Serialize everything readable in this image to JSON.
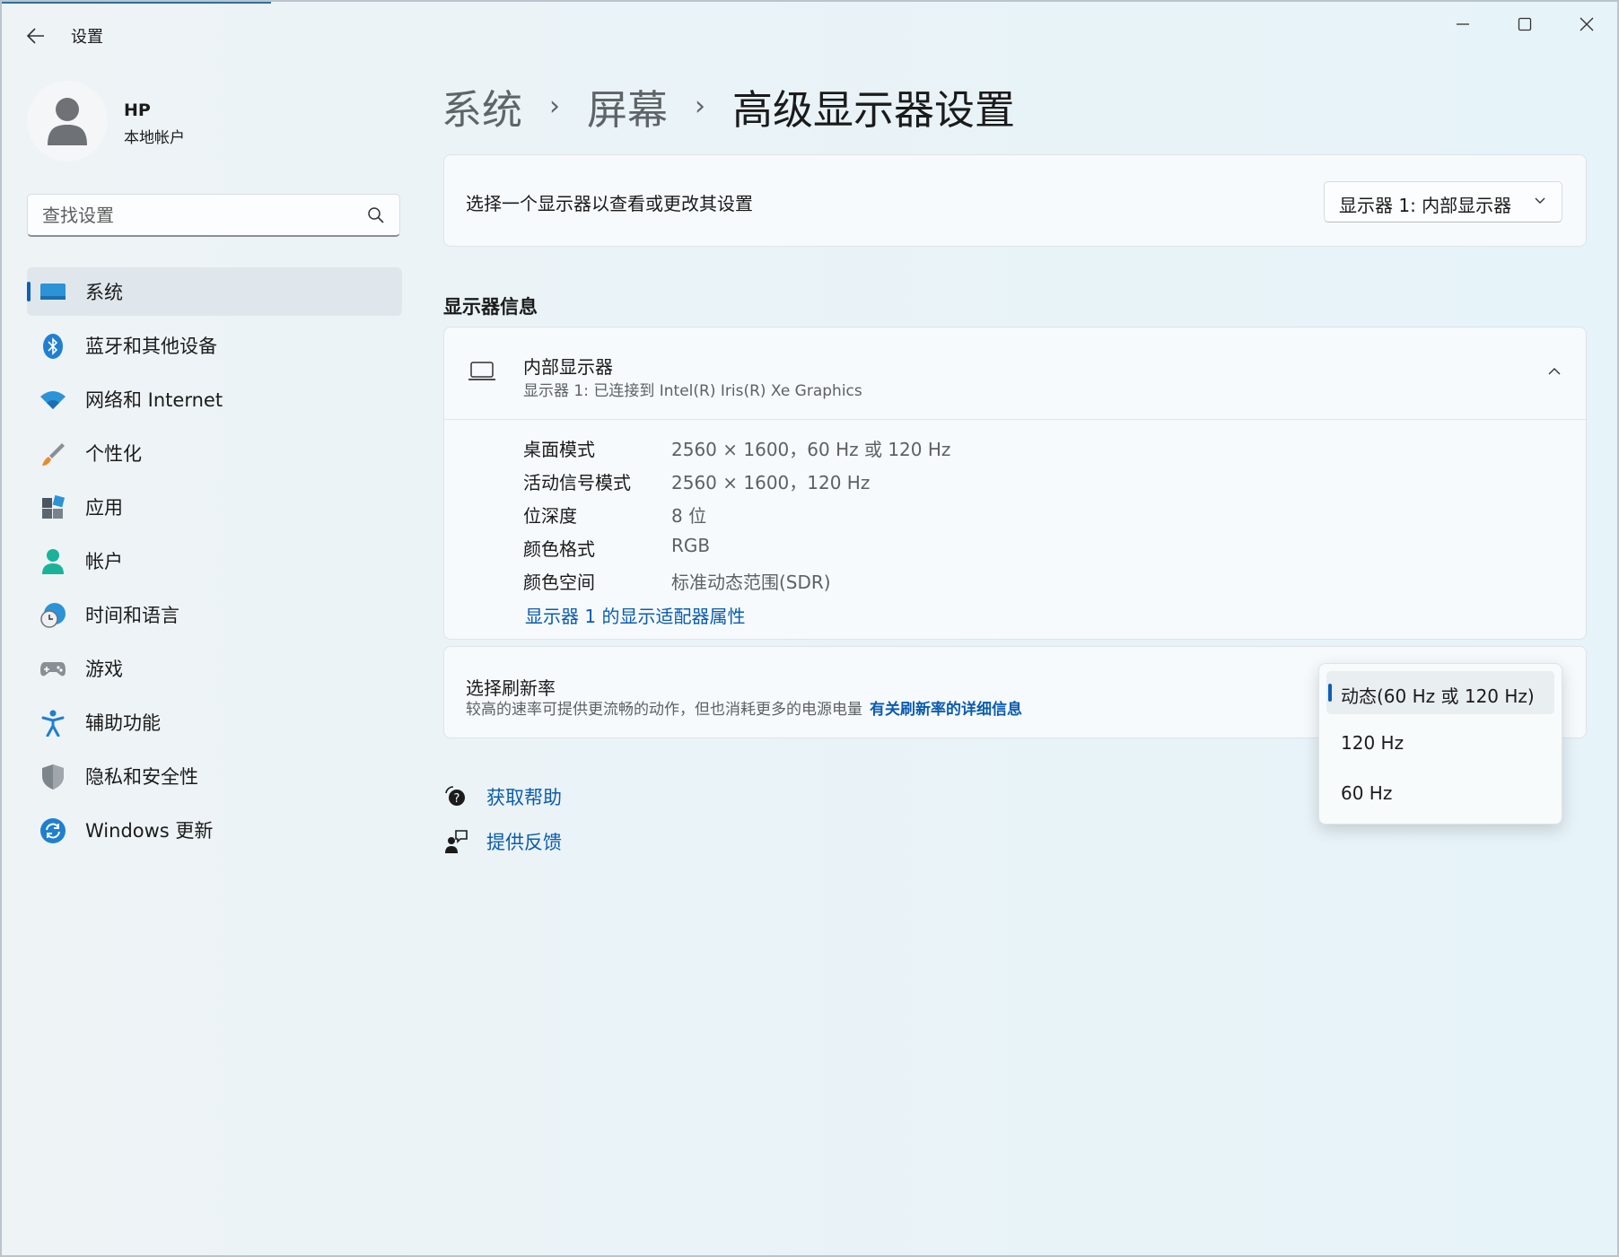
{
  "window": {
    "app_title": "设置",
    "accent": "#0d5fb8"
  },
  "titlebar": {
    "back_icon": "back-arrow-icon",
    "minimize_icon": "minimize-icon",
    "maximize_icon": "maximize-icon",
    "close_icon": "close-icon"
  },
  "profile": {
    "name": "HP",
    "account_type": "本地帐户"
  },
  "search": {
    "placeholder": "查找设置"
  },
  "sidebar": {
    "items": [
      {
        "label": "系统",
        "icon": "monitor-icon",
        "active": true
      },
      {
        "label": "蓝牙和其他设备",
        "icon": "bluetooth-icon"
      },
      {
        "label": "网络和 Internet",
        "icon": "wifi-icon"
      },
      {
        "label": "个性化",
        "icon": "paintbrush-icon"
      },
      {
        "label": "应用",
        "icon": "apps-icon"
      },
      {
        "label": "帐户",
        "icon": "account-icon"
      },
      {
        "label": "时间和语言",
        "icon": "time-language-icon"
      },
      {
        "label": "游戏",
        "icon": "gamepad-icon"
      },
      {
        "label": "辅助功能",
        "icon": "accessibility-icon"
      },
      {
        "label": "隐私和安全性",
        "icon": "shield-icon"
      },
      {
        "label": "Windows 更新",
        "icon": "update-icon"
      }
    ]
  },
  "breadcrumb": {
    "items": [
      "系统",
      "屏幕",
      "高级显示器设置"
    ]
  },
  "display_select": {
    "label": "选择一个显示器以查看或更改其设置",
    "value": "显示器 1: 内部显示器"
  },
  "display_info": {
    "heading": "显示器信息",
    "title": "内部显示器",
    "subtitle": "显示器 1: 已连接到 Intel(R) Iris(R) Xe Graphics",
    "properties": [
      {
        "key": "桌面模式",
        "value": "2560 × 1600，60 Hz 或 120 Hz"
      },
      {
        "key": "活动信号模式",
        "value": "2560 × 1600，120 Hz"
      },
      {
        "key": "位深度",
        "value": "8 位"
      },
      {
        "key": "颜色格式",
        "value": "RGB"
      },
      {
        "key": "颜色空间",
        "value": "标准动态范围(SDR)"
      }
    ],
    "adapter_link": "显示器 1 的显示适配器属性"
  },
  "refresh_rate": {
    "title": "选择刷新率",
    "description": "较高的速率可提供更流畅的动作，但也消耗更多的电源电量",
    "link": "有关刷新率的详细信息",
    "options": [
      "动态(60 Hz 或 120 Hz)",
      "120 Hz",
      "60 Hz"
    ],
    "selected": "动态(60 Hz 或 120 Hz)"
  },
  "help": {
    "get_help": "获取帮助",
    "feedback": "提供反馈"
  }
}
